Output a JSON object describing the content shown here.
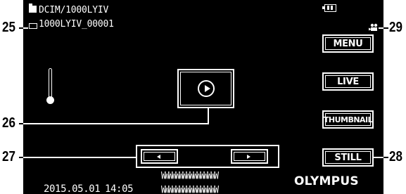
{
  "callouts": {
    "c25": "25",
    "c26": "26",
    "c27": "27",
    "c28": "28",
    "c29": "29"
  },
  "header": {
    "folder_path": "DCIM/1000LYIV",
    "file_name": "1000LYIV_00001"
  },
  "buttons": {
    "menu": "MENU",
    "live": "LIVE",
    "thumbnail": "THUMBNAIL",
    "still": "STILL"
  },
  "footer": {
    "date": "2015.05.01",
    "time": "14:05",
    "memo_line1": "WWWWWWWWWWWWWWWW",
    "memo_line2": "WWWWWWWWWWWWWWWW",
    "brand": "OLYMPUS"
  },
  "icons": [
    "folder-icon",
    "file-icon",
    "battery-icon",
    "movie-camera-icon",
    "thermometer-icon",
    "play-icon",
    "prev-arrow-icon",
    "next-arrow-icon"
  ],
  "colors": {
    "screen_background": "#000000",
    "foreground": "#ffffff",
    "page_background": "#ffffff"
  }
}
